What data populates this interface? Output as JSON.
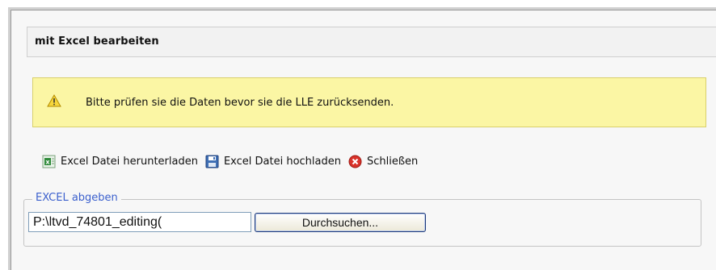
{
  "header": {
    "title": "mit Excel bearbeiten"
  },
  "warning": {
    "message": "Bitte prüfen sie die Daten bevor sie die LLE zurücksenden."
  },
  "actions": [
    {
      "label": "Excel Datei herunterladen",
      "icon": "excel-icon"
    },
    {
      "label": "Excel Datei hochladen",
      "icon": "save-disk-icon"
    },
    {
      "label": "Schließen",
      "icon": "close-icon"
    }
  ],
  "upload": {
    "legend": "EXCEL abgeben",
    "file_value": "P:\\ltvd_74801_editing(",
    "browse_label": "Durchsuchen..."
  },
  "colors": {
    "legend": "#3a5fcd",
    "warning_bg": "#fbf6a4",
    "close_red": "#d9322a",
    "excel_green": "#2f8a3a"
  }
}
